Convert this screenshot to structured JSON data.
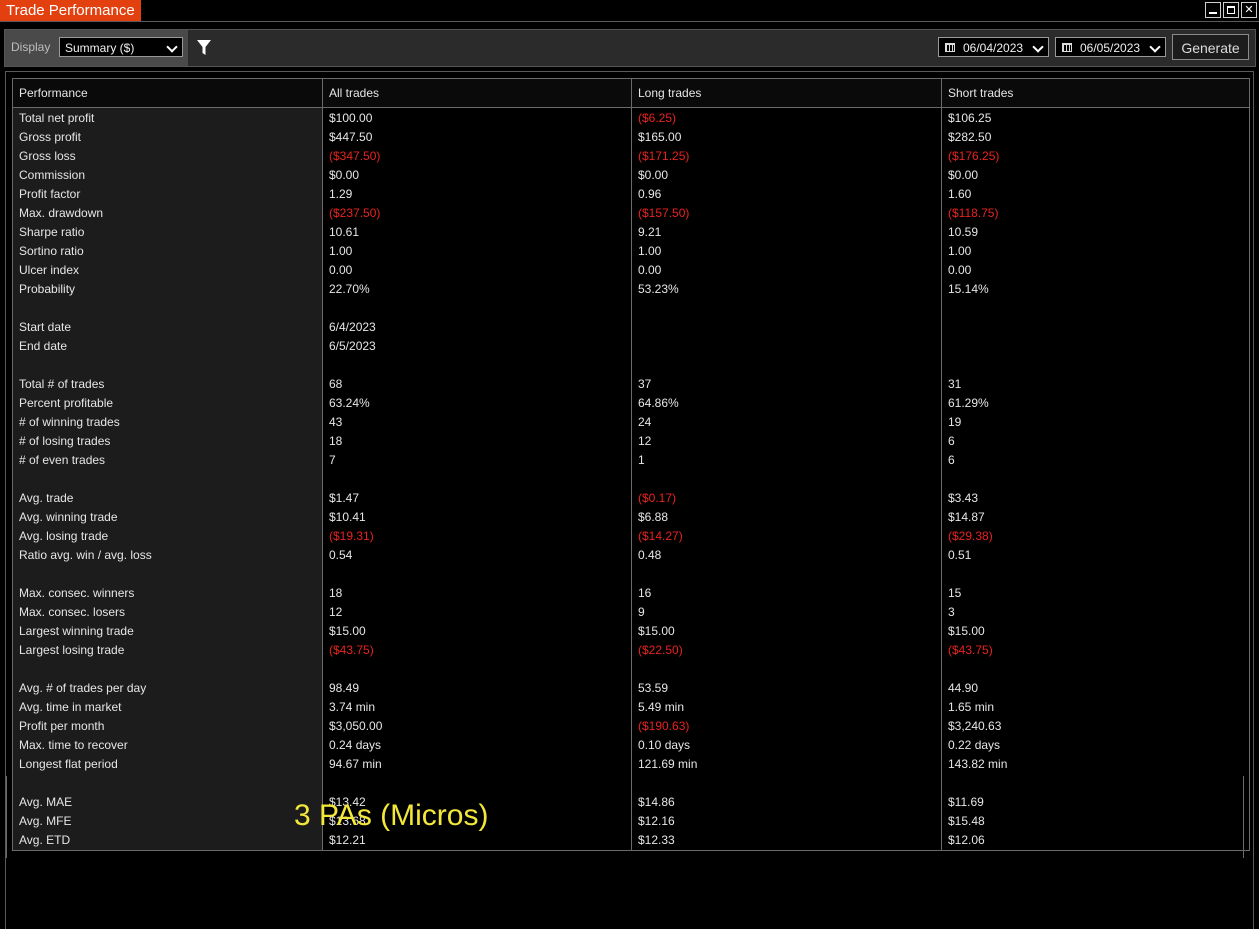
{
  "window": {
    "title": "Trade Performance"
  },
  "toolbar": {
    "display_label": "Display",
    "display_value": "Summary ($)",
    "date_from": "06/04/2023",
    "date_to": "06/05/2023",
    "generate_label": "Generate"
  },
  "colors": {
    "title_tab": "#e2400f",
    "negative": "#e8231f",
    "caption": "#f3e73a"
  },
  "table": {
    "headers": [
      "Performance",
      "All trades",
      "Long trades",
      "Short trades"
    ],
    "rows": [
      [
        "Total net profit",
        "$100.00",
        "($6.25)",
        "$106.25"
      ],
      [
        "Gross profit",
        "$447.50",
        "$165.00",
        "$282.50"
      ],
      [
        "Gross loss",
        "($347.50)",
        "($171.25)",
        "($176.25)"
      ],
      [
        "Commission",
        "$0.00",
        "$0.00",
        "$0.00"
      ],
      [
        "Profit factor",
        "1.29",
        "0.96",
        "1.60"
      ],
      [
        "Max. drawdown",
        "($237.50)",
        "($157.50)",
        "($118.75)"
      ],
      [
        "Sharpe ratio",
        "10.61",
        "9.21",
        "10.59"
      ],
      [
        "Sortino ratio",
        "1.00",
        "1.00",
        "1.00"
      ],
      [
        "Ulcer index",
        "0.00",
        "0.00",
        "0.00"
      ],
      [
        "Probability",
        "22.70%",
        "53.23%",
        "15.14%"
      ],
      [
        "",
        "",
        "",
        ""
      ],
      [
        "Start date",
        "6/4/2023",
        "",
        ""
      ],
      [
        "End date",
        "6/5/2023",
        "",
        ""
      ],
      [
        "",
        "",
        "",
        ""
      ],
      [
        "Total # of trades",
        "68",
        "37",
        "31"
      ],
      [
        "Percent profitable",
        "63.24%",
        "64.86%",
        "61.29%"
      ],
      [
        "# of winning trades",
        "43",
        "24",
        "19"
      ],
      [
        "# of losing trades",
        "18",
        "12",
        "6"
      ],
      [
        "# of even trades",
        "7",
        "1",
        "6"
      ],
      [
        "",
        "",
        "",
        ""
      ],
      [
        "Avg. trade",
        "$1.47",
        "($0.17)",
        "$3.43"
      ],
      [
        "Avg. winning trade",
        "$10.41",
        "$6.88",
        "$14.87"
      ],
      [
        "Avg. losing trade",
        "($19.31)",
        "($14.27)",
        "($29.38)"
      ],
      [
        "Ratio avg. win / avg. loss",
        "0.54",
        "0.48",
        "0.51"
      ],
      [
        "",
        "",
        "",
        ""
      ],
      [
        "Max. consec. winners",
        "18",
        "16",
        "15"
      ],
      [
        "Max. consec. losers",
        "12",
        "9",
        "3"
      ],
      [
        "Largest winning trade",
        "$15.00",
        "$15.00",
        "$15.00"
      ],
      [
        "Largest losing trade",
        "($43.75)",
        "($22.50)",
        "($43.75)"
      ],
      [
        "",
        "",
        "",
        ""
      ],
      [
        "Avg. # of trades per day",
        "98.49",
        "53.59",
        "44.90"
      ],
      [
        "Avg. time in market",
        "3.74 min",
        "5.49 min",
        "1.65 min"
      ],
      [
        "Profit per month",
        "$3,050.00",
        "($190.63)",
        "$3,240.63"
      ],
      [
        "Max. time to recover",
        "0.24 days",
        "0.10 days",
        "0.22 days"
      ],
      [
        "Longest flat period",
        "94.67 min",
        "121.69 min",
        "143.82 min"
      ],
      [
        "",
        "",
        "",
        ""
      ],
      [
        "Avg. MAE",
        "$13.42",
        "$14.86",
        "$11.69"
      ],
      [
        "Avg. MFE",
        "$13.68",
        "$12.16",
        "$15.48"
      ],
      [
        "Avg. ETD",
        "$12.21",
        "$12.33",
        "$12.06"
      ]
    ]
  },
  "annotation": {
    "caption": "3 PAs (Micros)"
  }
}
